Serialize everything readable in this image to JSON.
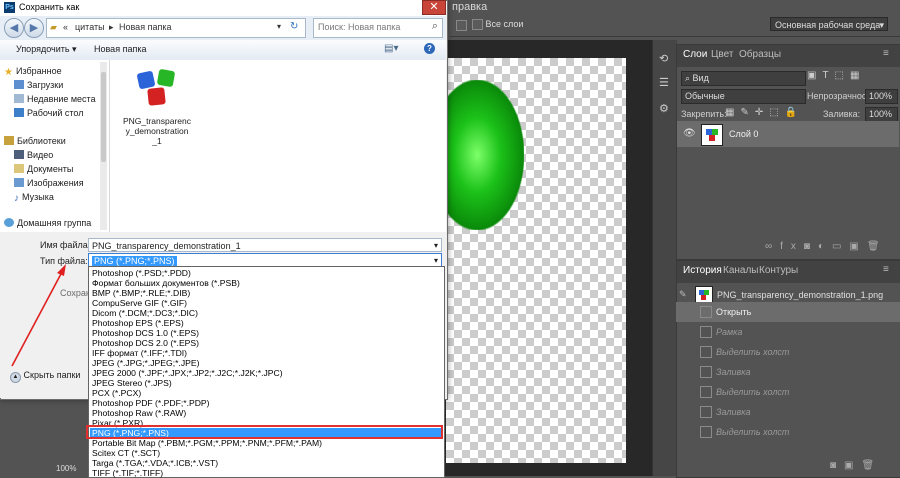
{
  "photoshop": {
    "menu_help": "правка",
    "options": {
      "all_layers": "Все слои",
      "workspace": "Основная рабочая среда"
    },
    "layers_panel": {
      "tabs": [
        "Слои",
        "Цвет",
        "Образцы"
      ],
      "filter": "Вид",
      "blend_mode": "Обычные",
      "opacity_label": "Непрозрачность:",
      "opacity_value": "100%",
      "lock_label": "Закрепить:",
      "fill_label": "Заливка:",
      "fill_value": "100%",
      "layer_name": "Слой 0"
    },
    "history_panel": {
      "tabs": [
        "История",
        "Каналы",
        "Контуры"
      ],
      "snapshot": "PNG_transparency_demonstration_1.png",
      "steps": [
        "Открыть",
        "Рамка",
        "Выделить холст",
        "Заливка",
        "Выделить холст",
        "Заливка",
        "Выделить холст"
      ]
    },
    "status_zoom": "100%"
  },
  "dialog": {
    "title": "Сохранить как",
    "breadcrumb": [
      "«",
      "цитаты",
      "Новая папка"
    ],
    "search_placeholder": "Поиск: Новая папка",
    "toolbar": {
      "organize": "Упорядочить ▾",
      "new_folder": "Новая папка"
    },
    "nav": {
      "favorites": "Избранное",
      "downloads": "Загрузки",
      "recent": "Недавние места",
      "desktop": "Рабочий стол",
      "libraries": "Библиотеки",
      "video": "Видео",
      "documents": "Документы",
      "images": "Изображения",
      "music": "Музыка",
      "homegroup": "Домашняя группа"
    },
    "file": {
      "name_line1": "PNG_transparenc",
      "name_line2": "y_demonstration",
      "name_line3": "_1"
    },
    "form": {
      "filename_label": "Имя файла:",
      "filename_value": "PNG_transparency_demonstration_1",
      "filetype_label": "Тип файла:",
      "filetype_value": "PNG (*.PNG;*.PNS)",
      "save_partial": "Сохран",
      "hide_folders": "Скрыть папки"
    },
    "file_types": [
      "Photoshop (*.PSD;*.PDD)",
      "Формат больших документов (*.PSB)",
      "BMP (*.BMP;*.RLE;*.DIB)",
      "CompuServe GIF (*.GIF)",
      "Dicom (*.DCM;*.DC3;*.DIC)",
      "Photoshop EPS (*.EPS)",
      "Photoshop DCS 1.0 (*.EPS)",
      "Photoshop DCS 2.0 (*.EPS)",
      "IFF формат (*.IFF;*.TDI)",
      "JPEG (*.JPG;*.JPEG;*.JPE)",
      "JPEG 2000 (*.JPF;*.JPX;*.JP2;*.J2C;*.J2K;*.JPC)",
      "JPEG Stereo (*.JPS)",
      "PCX (*.PCX)",
      "Photoshop PDF (*.PDF;*.PDP)",
      "Photoshop Raw (*.RAW)",
      "Pixar (*.PXR)",
      "PNG (*.PNG;*.PNS)",
      "Portable Bit Map (*.PBM;*.PGM;*.PPM;*.PNM;*.PFM;*.PAM)",
      "Scitex CT (*.SCT)",
      "Targa (*.TGA;*.VDA;*.ICB;*.VST)",
      "TIFF (*.TIF;*.TIFF)"
    ],
    "selected_index": 16
  },
  "colors": {
    "selection": "#3399ff",
    "highlight_box": "#e03030",
    "close_button": "#c9453a"
  }
}
